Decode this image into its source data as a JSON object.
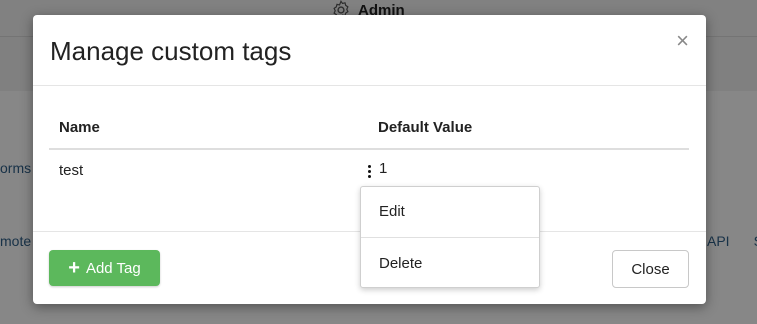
{
  "background": {
    "admin_label": "Admin",
    "left_partial_1": "orms",
    "left_partial_2": "mote",
    "right_partial_1": "API",
    "right_partial_2": "S"
  },
  "modal": {
    "title": "Manage custom tags",
    "close_icon": "×",
    "table": {
      "headers": {
        "name": "Name",
        "default_value": "Default Value"
      },
      "rows": [
        {
          "name": "test",
          "default_value": "1"
        }
      ]
    },
    "add_button_label": "Add Tag",
    "add_button_icon": "+",
    "close_button_label": "Close"
  },
  "row_menu": {
    "items": [
      "Edit",
      "Delete"
    ]
  },
  "colors": {
    "add_button": "#5cb85c",
    "overlay": "rgba(0,0,0,0.47)"
  },
  "icons": {
    "admin": "gear-icon",
    "add": "plus-icon",
    "row_actions": "kebab-menu-icon",
    "dialog_close": "close-icon"
  }
}
